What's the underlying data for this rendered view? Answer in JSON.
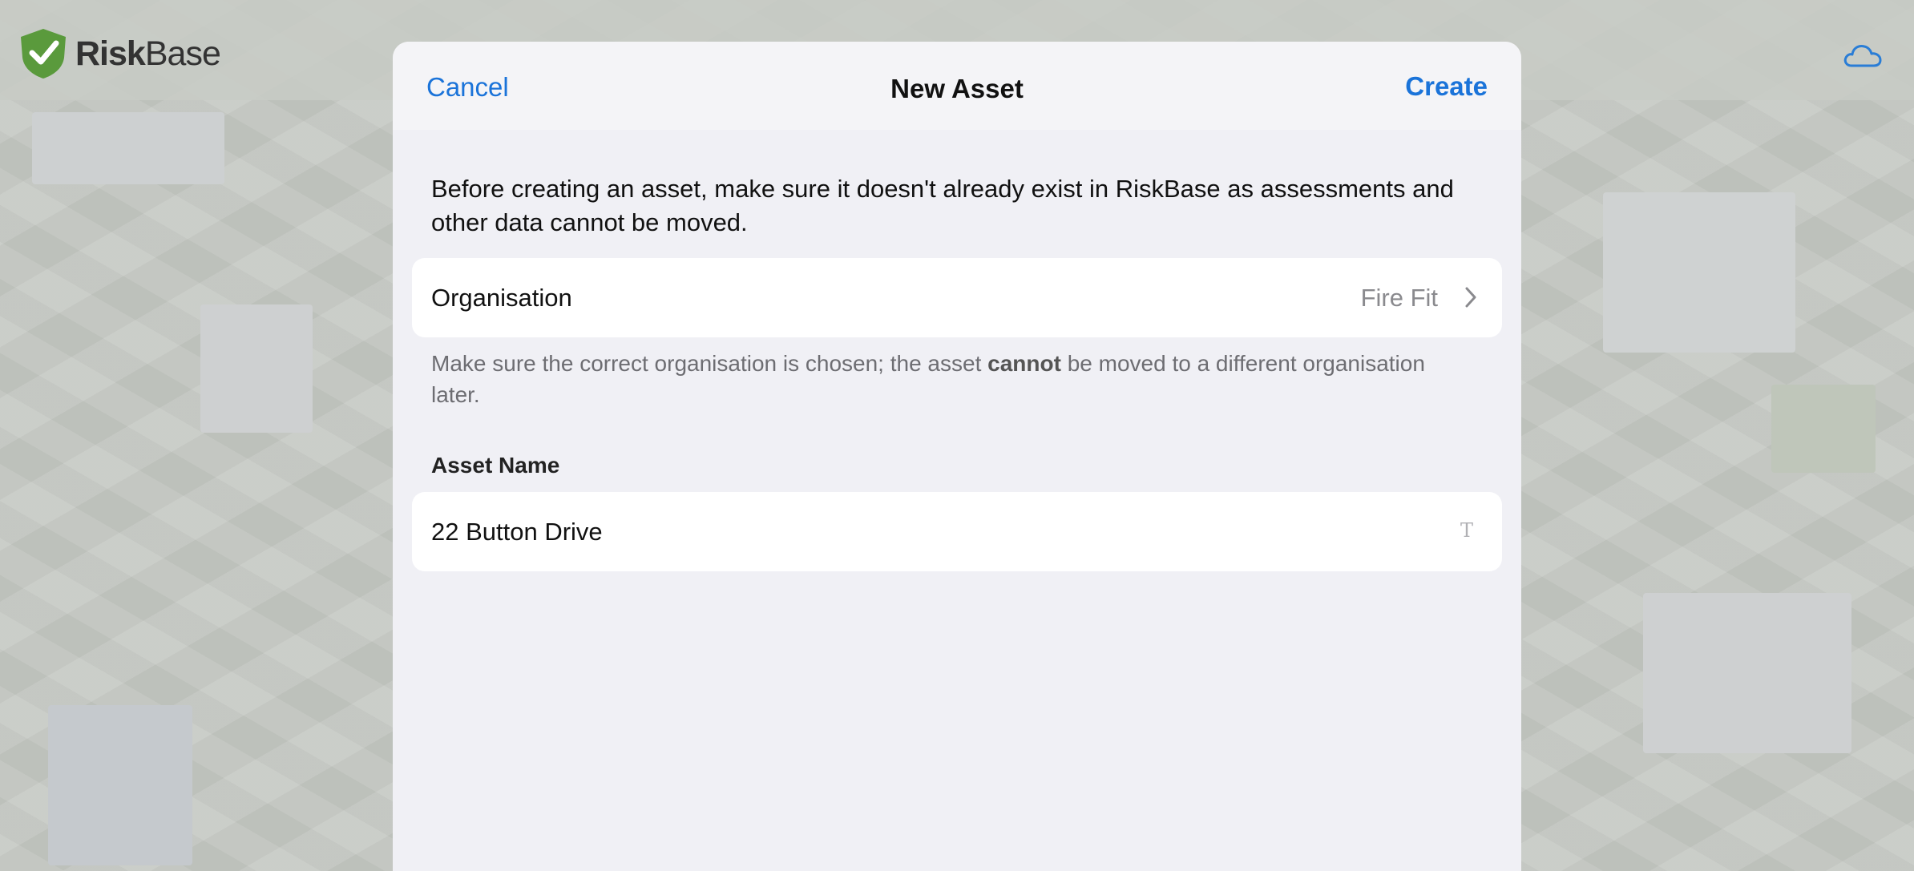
{
  "app": {
    "name_part1": "Risk",
    "name_part2": "Base"
  },
  "topbar": {
    "logo_icon": "shield-check-icon",
    "sync_icon": "cloud-icon"
  },
  "sheet": {
    "cancel_label": "Cancel",
    "title": "New Asset",
    "create_label": "Create",
    "intro_text": "Before creating an asset, make sure it doesn't already exist in RiskBase as assessments and other data cannot be moved.",
    "organisation": {
      "label": "Organisation",
      "value": "Fire Fit",
      "icon": "chevron-right-icon"
    },
    "hint": {
      "before": "Make sure the correct organisation is chosen; the asset ",
      "emphasis": "cannot",
      "after": " be moved to a different organisation later."
    },
    "asset_name": {
      "section_label": "Asset Name",
      "value": "22 Button Drive",
      "icon": "text-format-icon",
      "icon_glyph": "T"
    }
  },
  "colors": {
    "accent": "#1a73d9",
    "brand_green": "#5a9a3c"
  }
}
